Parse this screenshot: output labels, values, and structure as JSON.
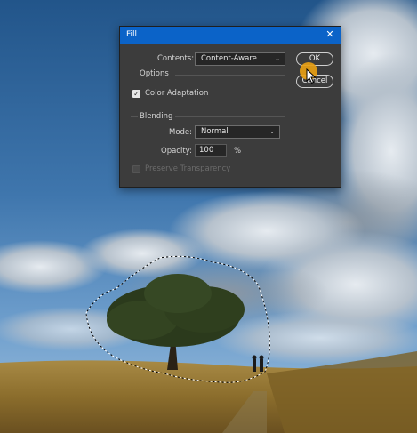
{
  "dialog": {
    "title": "Fill",
    "close_icon": "close-icon",
    "contents_label": "Contents:",
    "contents_value": "Content-Aware",
    "options_heading": "Options",
    "color_adaptation_label": "Color Adaptation",
    "color_adaptation_checked": true,
    "blending_heading": "Blending",
    "mode_label": "Mode:",
    "mode_value": "Normal",
    "opacity_label": "Opacity:",
    "opacity_value": "100",
    "opacity_unit": "%",
    "preserve_transparency_label": "Preserve Transparency",
    "preserve_transparency_checked": false,
    "preserve_transparency_enabled": false,
    "ok_label": "OK",
    "cancel_label": "Cancel"
  },
  "colors": {
    "titlebar": "#0b63c8",
    "dialog_bg": "#3c3c3c",
    "cursor_highlight": "#e8a014"
  }
}
